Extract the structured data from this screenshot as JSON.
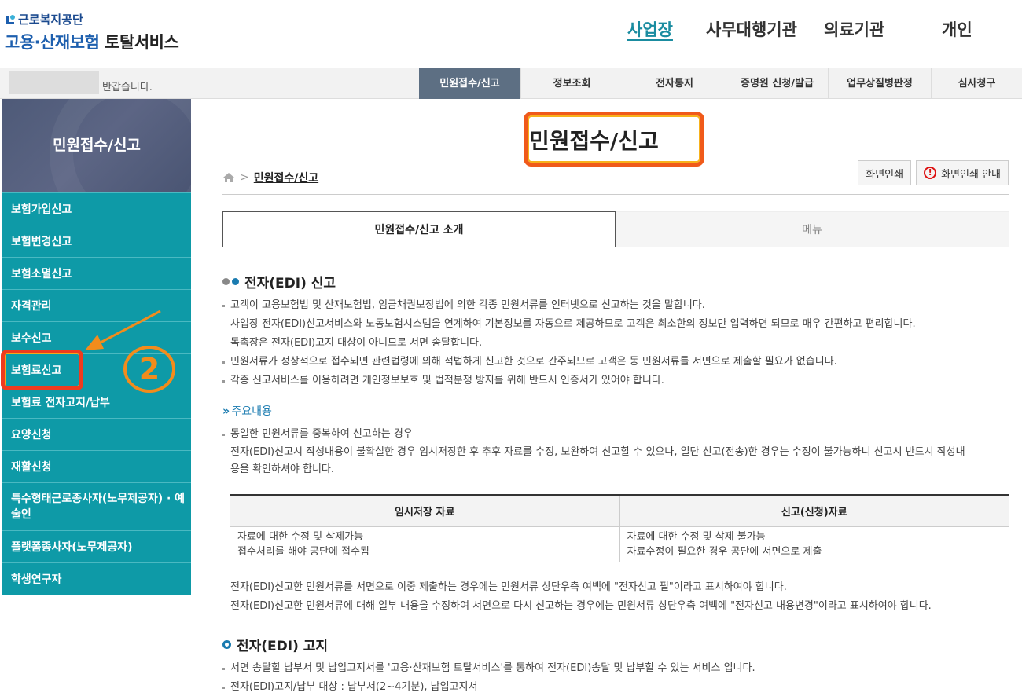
{
  "header": {
    "org": "근로복지공단",
    "service_blue": "고용·산재보험",
    "service_dark": "토탈서비스",
    "nav": [
      "사업장",
      "사무대행기관",
      "의료기관",
      "개인"
    ]
  },
  "subbar": {
    "greeting": "반갑습니다.",
    "tabs": [
      "민원접수/신고",
      "정보조회",
      "전자통지",
      "증명원 신청/발급",
      "업무상질병판정",
      "심사청구"
    ]
  },
  "sidebar": {
    "title": "민원접수/신고",
    "items": [
      "보험가입신고",
      "보험변경신고",
      "보험소멸신고",
      "자격관리",
      "보수신고",
      "보험료신고",
      "보험료 전자고지/납부",
      "요양신청",
      "재활신청",
      "특수형태근로종사자(노무제공자) · 예술인",
      "플랫폼종사자(노무제공자)",
      "학생연구자"
    ]
  },
  "annotation": {
    "step": "2"
  },
  "main": {
    "title": "민원접수/신고",
    "breadcrumb": "민원접수/신고",
    "print_btn": "화면인쇄",
    "print_guide_btn": "화면인쇄 안내",
    "tabs": [
      "민원접수/신고 소개",
      "메뉴"
    ],
    "edi": {
      "heading": "전자(EDI) 신고",
      "lines": [
        "고객이 고용보험법 및 산재보험법, 임금채권보장법에 의한 각종 민원서류를 인터넷으로 신고하는 것을 말합니다.",
        "사업장 전자(EDI)신고서비스와 노동보험시스템을 연계하여 기본정보를 자동으로 제공하므로 고객은 최소한의 정보만 입력하면 되므로 매우 간편하고 편리합니다.",
        "독촉장은 전자(EDI)고지 대상이 아니므로 서면 송달합니다.",
        "민원서류가 정상적으로 접수되면 관련법령에 의해 적법하게 신고한 것으로 간주되므로 고객은 동 민원서류를 서면으로 제출할 필요가 없습니다.",
        "각종 신고서비스를 이용하려면 개인정보보호 및 법적분쟁 방지를 위해 반드시 인증서가 있어야 합니다."
      ]
    },
    "main_content": {
      "heading": "주요내용",
      "line1": "동일한 민원서류를 중복하여 신고하는 경우",
      "line2": "전자(EDI)신고시 작성내용이 불확실한 경우 임시저장한 후 추후 자료를 수정, 보완하여 신고할 수 있으나, 일단 신고(전송)한 경우는 수정이 불가능하니 신고시 반드시 작성내",
      "line3": "용을 확인하셔야 합니다."
    },
    "table": {
      "headers": [
        "임시저장 자료",
        "신고(신청)자료"
      ],
      "col1": [
        "자료에 대한 수정 및 삭제가능",
        "접수처리를 해야 공단에 접수됨"
      ],
      "col2": [
        "자료에 대한 수정 및 삭제 불가능",
        "자료수정이 필요한 경우 공단에 서면으로 제출"
      ]
    },
    "after_table": [
      "전자(EDI)신고한 민원서류를 서면으로 이중 제출하는 경우에는 민원서류 상단우측 여백에 \"전자신고 필\"이라고 표시하여야 합니다.",
      "전자(EDI)신고한 민원서류에 대해 일부 내용을 수정하여 서면으로 다시 신고하는 경우에는 민원서류 상단우측 여백에 \"전자신고 내용변경\"이라고 표시하여야 합니다."
    ],
    "edi_notice": {
      "heading": "전자(EDI) 고지",
      "lines": [
        "서면 송달할 납부서 및 납입고지서를 '고용·산재보험 토탈서비스'를 통하여 전자(EDI)송달 및 납부할 수 있는 서비스 입니다.",
        "전자(EDI)고지/납부 대상 : 납부서(2~4기분), 납입고지서"
      ]
    }
  }
}
